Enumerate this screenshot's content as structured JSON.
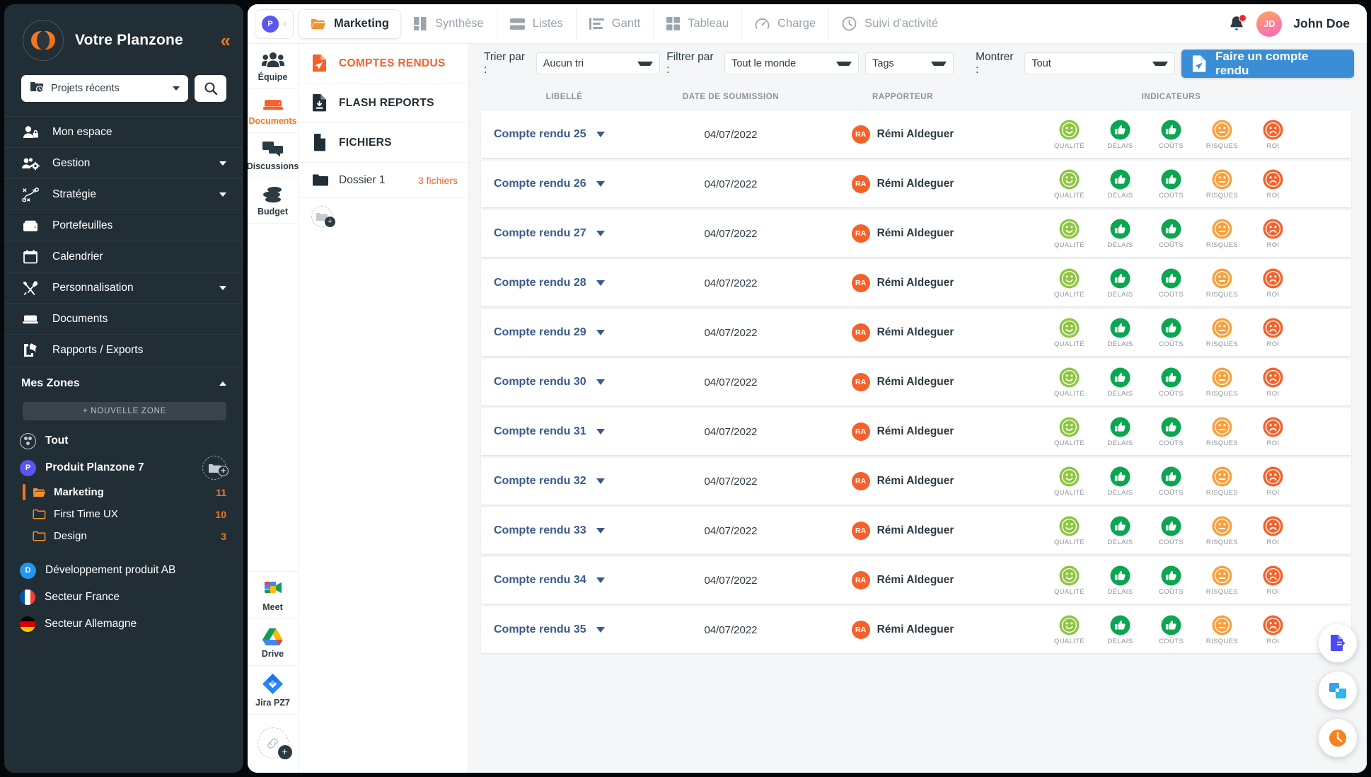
{
  "sidebar": {
    "brand": "Votre Planzone",
    "collapse_icon": "chevrons-left-icon",
    "project_select": {
      "value": "Projets récents",
      "icon": "folder-clock-icon"
    },
    "search_icon": "search-icon",
    "nav": [
      {
        "label": "Mon espace",
        "icon": "user-lock-icon",
        "expandable": false
      },
      {
        "label": "Gestion",
        "icon": "users-gear-icon",
        "expandable": true
      },
      {
        "label": "Stratégie",
        "icon": "strategy-icon",
        "expandable": true
      },
      {
        "label": "Portefeuilles",
        "icon": "briefcase-icon",
        "expandable": false
      },
      {
        "label": "Calendrier",
        "icon": "calendar-icon",
        "expandable": false
      },
      {
        "label": "Personnalisation",
        "icon": "tools-icon",
        "expandable": true
      },
      {
        "label": "Documents",
        "icon": "documents-icon",
        "expandable": false
      },
      {
        "label": "Rapports / Exports",
        "icon": "export-icon",
        "expandable": false
      }
    ],
    "zones": {
      "title": "Mes Zones",
      "new_zone_label": "+ NOUVELLE ZONE",
      "items": [
        {
          "label": "Tout",
          "badge": "",
          "badge_color": "",
          "type": "all",
          "icon": "zones-circle-icon"
        },
        {
          "label": "Produit Planzone 7",
          "badge": "P",
          "badge_color": "#5b55ef",
          "type": "project",
          "add_icon": "add-folder-icon"
        },
        {
          "label": "Développement produit AB",
          "badge": "D",
          "badge_color": "#2196f3",
          "type": "project"
        },
        {
          "label": "Secteur France",
          "badge": "",
          "type": "flag-fr",
          "icon": "flag-france-icon"
        },
        {
          "label": "Secteur Allemagne",
          "badge": "",
          "type": "flag-de",
          "icon": "flag-germany-icon"
        }
      ],
      "subitems": [
        {
          "label": "Marketing",
          "count": "11",
          "active": true
        },
        {
          "label": "First Time UX",
          "count": "10",
          "active": false
        },
        {
          "label": "Design",
          "count": "3",
          "active": false
        }
      ]
    }
  },
  "topnav": {
    "project_badge": "P",
    "back_icon": "chevron-left-icon",
    "tabs": [
      {
        "label": "Marketing",
        "icon": "folder-open-icon",
        "active": true
      },
      {
        "label": "Synthèse",
        "icon": "dashboard-icon",
        "active": false
      },
      {
        "label": "Listes",
        "icon": "list-icon",
        "active": false
      },
      {
        "label": "Gantt",
        "icon": "gantt-icon",
        "active": false
      },
      {
        "label": "Tableau",
        "icon": "grid-icon",
        "active": false
      },
      {
        "label": "Charge",
        "icon": "gauge-icon",
        "active": false
      },
      {
        "label": "Suivi d'activité",
        "icon": "clock-icon",
        "active": false
      }
    ],
    "bell_icon": "notification-bell-icon",
    "user": {
      "initials": "JD",
      "name": "John Doe"
    }
  },
  "rail": [
    {
      "label": "Équipe",
      "icon": "team-icon",
      "active": false
    },
    {
      "label": "Documents",
      "icon": "documents-box-icon",
      "active": true
    },
    {
      "label": "Discussions",
      "icon": "chat-icon",
      "active": false
    },
    {
      "label": "Budget",
      "icon": "coins-icon",
      "active": false
    }
  ],
  "rail_apps": [
    {
      "label": "Meet",
      "icon": "google-meet-icon"
    },
    {
      "label": "Drive",
      "icon": "google-drive-icon"
    },
    {
      "label": "Jira PZ7",
      "icon": "jira-icon"
    }
  ],
  "rail_add_icon": "add-link-icon",
  "docpanel": {
    "items": [
      {
        "label": "COMPTES RENDUS",
        "icon": "report-send-icon",
        "active": true
      },
      {
        "label": "FLASH REPORTS",
        "icon": "flash-report-icon",
        "active": false
      },
      {
        "label": "FICHIERS",
        "icon": "file-icon",
        "active": false
      }
    ],
    "folders": [
      {
        "label": "Dossier 1",
        "count": "3 fichiers",
        "icon": "folder-icon"
      }
    ],
    "add_folder_icon": "add-folder-icon"
  },
  "filters": {
    "sort_label": "Trier par :",
    "sort_value": "Aucun tri",
    "filter_label": "Filtrer par :",
    "filter_value": "Tout le monde",
    "tags_value": "Tags",
    "show_label": "Montrer :",
    "show_value": "Tout",
    "cta_label": "Faire un compte rendu",
    "cta_icon": "create-report-icon",
    "cta_color": "#3b8ed6"
  },
  "table": {
    "columns": [
      "LIBELLÉ",
      "DATE DE SOUMISSION",
      "RAPPORTEUR",
      "INDICATEURS"
    ],
    "indicator_labels": [
      "QUALITÉ",
      "DÉLAIS",
      "COÛTS",
      "RISQUES",
      "ROI"
    ],
    "rows": [
      {
        "label": "Compte rendu 25",
        "date": "04/07/2022",
        "reporter": "Rémi Aldeguer",
        "initials": "RA",
        "indicators": [
          {
            "type": "smiley-happy",
            "color": "#8cc63f"
          },
          {
            "type": "thumb-up",
            "color": "#0aa650"
          },
          {
            "type": "thumb-up",
            "color": "#0aa650"
          },
          {
            "type": "smiley-neutral",
            "color": "#f9a03c"
          },
          {
            "type": "smiley-sad",
            "color": "#f4622c"
          }
        ]
      },
      {
        "label": "Compte rendu 26",
        "date": "04/07/2022",
        "reporter": "Rémi Aldeguer",
        "initials": "RA",
        "indicators": [
          {
            "type": "smiley-happy",
            "color": "#8cc63f"
          },
          {
            "type": "thumb-up",
            "color": "#0aa650"
          },
          {
            "type": "thumb-up",
            "color": "#0aa650"
          },
          {
            "type": "smiley-neutral",
            "color": "#f9a03c"
          },
          {
            "type": "smiley-sad",
            "color": "#f4622c"
          }
        ]
      },
      {
        "label": "Compte rendu 27",
        "date": "04/07/2022",
        "reporter": "Rémi Aldeguer",
        "initials": "RA",
        "indicators": [
          {
            "type": "smiley-happy",
            "color": "#8cc63f"
          },
          {
            "type": "thumb-up",
            "color": "#0aa650"
          },
          {
            "type": "thumb-up",
            "color": "#0aa650"
          },
          {
            "type": "smiley-neutral",
            "color": "#f9a03c"
          },
          {
            "type": "smiley-sad",
            "color": "#f4622c"
          }
        ]
      },
      {
        "label": "Compte rendu 28",
        "date": "04/07/2022",
        "reporter": "Rémi Aldeguer",
        "initials": "RA",
        "indicators": [
          {
            "type": "smiley-happy",
            "color": "#8cc63f"
          },
          {
            "type": "thumb-up",
            "color": "#0aa650"
          },
          {
            "type": "thumb-up",
            "color": "#0aa650"
          },
          {
            "type": "smiley-neutral",
            "color": "#f9a03c"
          },
          {
            "type": "smiley-sad",
            "color": "#f4622c"
          }
        ]
      },
      {
        "label": "Compte rendu 29",
        "date": "04/07/2022",
        "reporter": "Rémi Aldeguer",
        "initials": "RA",
        "indicators": [
          {
            "type": "smiley-happy",
            "color": "#8cc63f"
          },
          {
            "type": "thumb-up",
            "color": "#0aa650"
          },
          {
            "type": "thumb-up",
            "color": "#0aa650"
          },
          {
            "type": "smiley-neutral",
            "color": "#f9a03c"
          },
          {
            "type": "smiley-sad",
            "color": "#f4622c"
          }
        ]
      },
      {
        "label": "Compte rendu 30",
        "date": "04/07/2022",
        "reporter": "Rémi Aldeguer",
        "initials": "RA",
        "indicators": [
          {
            "type": "smiley-happy",
            "color": "#8cc63f"
          },
          {
            "type": "thumb-up",
            "color": "#0aa650"
          },
          {
            "type": "thumb-up",
            "color": "#0aa650"
          },
          {
            "type": "smiley-neutral",
            "color": "#f9a03c"
          },
          {
            "type": "smiley-sad",
            "color": "#f4622c"
          }
        ]
      },
      {
        "label": "Compte rendu 31",
        "date": "04/07/2022",
        "reporter": "Rémi Aldeguer",
        "initials": "RA",
        "indicators": [
          {
            "type": "smiley-happy",
            "color": "#8cc63f"
          },
          {
            "type": "thumb-up",
            "color": "#0aa650"
          },
          {
            "type": "thumb-up",
            "color": "#0aa650"
          },
          {
            "type": "smiley-neutral",
            "color": "#f9a03c"
          },
          {
            "type": "smiley-sad",
            "color": "#f4622c"
          }
        ]
      },
      {
        "label": "Compte rendu 32",
        "date": "04/07/2022",
        "reporter": "Rémi Aldeguer",
        "initials": "RA",
        "indicators": [
          {
            "type": "smiley-happy",
            "color": "#8cc63f"
          },
          {
            "type": "thumb-up",
            "color": "#0aa650"
          },
          {
            "type": "thumb-up",
            "color": "#0aa650"
          },
          {
            "type": "smiley-neutral",
            "color": "#f9a03c"
          },
          {
            "type": "smiley-sad",
            "color": "#f4622c"
          }
        ]
      },
      {
        "label": "Compte rendu 33",
        "date": "04/07/2022",
        "reporter": "Rémi Aldeguer",
        "initials": "RA",
        "indicators": [
          {
            "type": "smiley-happy",
            "color": "#8cc63f"
          },
          {
            "type": "thumb-up",
            "color": "#0aa650"
          },
          {
            "type": "thumb-up",
            "color": "#0aa650"
          },
          {
            "type": "smiley-neutral",
            "color": "#f9a03c"
          },
          {
            "type": "smiley-sad",
            "color": "#f4622c"
          }
        ]
      },
      {
        "label": "Compte rendu 34",
        "date": "04/07/2022",
        "reporter": "Rémi Aldeguer",
        "initials": "RA",
        "indicators": [
          {
            "type": "smiley-happy",
            "color": "#8cc63f"
          },
          {
            "type": "thumb-up",
            "color": "#0aa650"
          },
          {
            "type": "thumb-up",
            "color": "#0aa650"
          },
          {
            "type": "smiley-neutral",
            "color": "#f9a03c"
          },
          {
            "type": "smiley-sad",
            "color": "#f4622c"
          }
        ]
      },
      {
        "label": "Compte rendu 35",
        "date": "04/07/2022",
        "reporter": "Rémi Aldeguer",
        "initials": "RA",
        "indicators": [
          {
            "type": "smiley-happy",
            "color": "#8cc63f"
          },
          {
            "type": "thumb-up",
            "color": "#0aa650"
          },
          {
            "type": "thumb-up",
            "color": "#0aa650"
          },
          {
            "type": "smiley-neutral",
            "color": "#f9a03c"
          },
          {
            "type": "smiley-sad",
            "color": "#f4622c"
          }
        ]
      }
    ]
  },
  "fabs": [
    {
      "icon": "export-doc-icon",
      "color": "#4b4bf5"
    },
    {
      "icon": "layers-icon",
      "color": "#2196f3"
    },
    {
      "icon": "clock-orange-icon",
      "color": "#f7821b"
    }
  ]
}
